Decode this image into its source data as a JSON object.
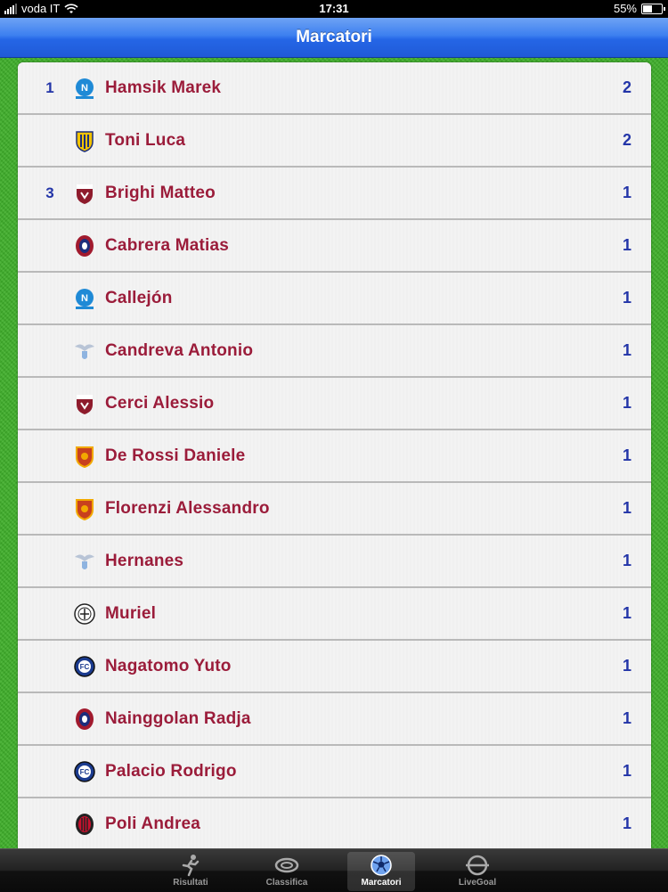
{
  "status": {
    "carrier": "voda IT",
    "time": "17:31",
    "battery": "55%"
  },
  "nav": {
    "title": "Marcatori"
  },
  "scorers": [
    {
      "rank": "1",
      "name": "Hamsik Marek",
      "goals": "2",
      "crest": "napoli-crest-icon"
    },
    {
      "rank": "",
      "name": "Toni Luca",
      "goals": "2",
      "crest": "verona-crest-icon"
    },
    {
      "rank": "3",
      "name": "Brighi Matteo",
      "goals": "1",
      "crest": "torino-crest-icon"
    },
    {
      "rank": "",
      "name": "Cabrera Matias",
      "goals": "1",
      "crest": "cagliari-crest-icon"
    },
    {
      "rank": "",
      "name": "Callejón",
      "goals": "1",
      "crest": "napoli-crest-icon"
    },
    {
      "rank": "",
      "name": "Candreva Antonio",
      "goals": "1",
      "crest": "lazio-crest-icon"
    },
    {
      "rank": "",
      "name": "Cerci Alessio",
      "goals": "1",
      "crest": "torino-crest-icon"
    },
    {
      "rank": "",
      "name": "De Rossi Daniele",
      "goals": "1",
      "crest": "roma-crest-icon"
    },
    {
      "rank": "",
      "name": "Florenzi Alessandro",
      "goals": "1",
      "crest": "roma-crest-icon"
    },
    {
      "rank": "",
      "name": "Hernanes",
      "goals": "1",
      "crest": "lazio-crest-icon"
    },
    {
      "rank": "",
      "name": "Muriel",
      "goals": "1",
      "crest": "udinese-crest-icon"
    },
    {
      "rank": "",
      "name": "Nagatomo Yuto",
      "goals": "1",
      "crest": "inter-crest-icon"
    },
    {
      "rank": "",
      "name": "Nainggolan Radja",
      "goals": "1",
      "crest": "cagliari-crest-icon"
    },
    {
      "rank": "",
      "name": "Palacio Rodrigo",
      "goals": "1",
      "crest": "inter-crest-icon"
    },
    {
      "rank": "",
      "name": "Poli Andrea",
      "goals": "1",
      "crest": "milan-crest-icon"
    }
  ],
  "tabs": [
    {
      "label": "Risultati",
      "icon": "runner-icon",
      "active": false
    },
    {
      "label": "Classifica",
      "icon": "stadium-icon",
      "active": false
    },
    {
      "label": "Marcatori",
      "icon": "soccer-ball-icon",
      "active": true
    },
    {
      "label": "LiveGoal",
      "icon": "pitch-icon",
      "active": false
    }
  ],
  "colors": {
    "rank_and_goals": "#2335a8",
    "player_name": "#9b1c3a",
    "grass": "#3fae2a",
    "navbar": "#2566e6"
  }
}
